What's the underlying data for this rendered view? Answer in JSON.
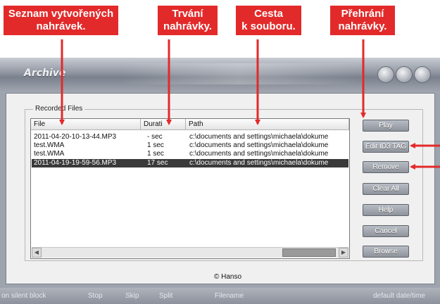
{
  "callouts": [
    {
      "line1": "Seznam vytvořených",
      "line2": "nahrávek."
    },
    {
      "line1": "Trvání",
      "line2": "nahrávky."
    },
    {
      "line1": "Cesta",
      "line2": "k souboru."
    },
    {
      "line1": "Přehrání",
      "line2": "nahrávky."
    }
  ],
  "window": {
    "title": "Archive"
  },
  "group": {
    "label": "Recorded Files"
  },
  "columns": {
    "file": "File",
    "duration": "Durati",
    "path": "Path"
  },
  "rows": [
    {
      "file": "2011-04-20-10-13-44.MP3",
      "duration": "- sec",
      "path": "c:\\documents and settings\\michaela\\dokume",
      "selected": false
    },
    {
      "file": "test.WMA",
      "duration": "1 sec",
      "path": "c:\\documents and settings\\michaela\\dokume",
      "selected": false
    },
    {
      "file": "test.WMA",
      "duration": "1 sec",
      "path": "c:\\documents and settings\\michaela\\dokume",
      "selected": false
    },
    {
      "file": "2011-04-19-19-59-56.MP3",
      "duration": "17 sec",
      "path": "c:\\documents and settings\\michaela\\dokume",
      "selected": true
    }
  ],
  "buttons": {
    "play": "Play",
    "edit_id3": "Edit ID3 TAG",
    "remove": "Remove",
    "clear_all": "Clear All",
    "help": "Help",
    "cancel": "Cancel",
    "browse": "Browse"
  },
  "footer": {
    "copyright": "© Hanso"
  },
  "statusbar": {
    "silent": "on silent block",
    "stop": "Stop",
    "skip": "Skip",
    "split": "Split",
    "filename": "Filename",
    "datetime": "default date/time"
  },
  "colors": {
    "callout": "#e32a2a",
    "selection": "#3a3a3a"
  }
}
